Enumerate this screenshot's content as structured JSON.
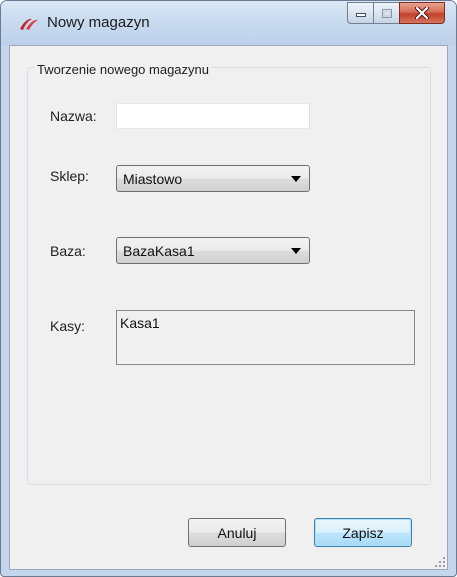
{
  "window": {
    "title": "Nowy magazyn",
    "icon": "app-logo-icon",
    "caption": {
      "minimize_icon": "minimize-icon",
      "maximize_icon": "maximize-icon",
      "close_icon": "close-icon"
    }
  },
  "group": {
    "title": "Tworzenie nowego magazynu"
  },
  "form": {
    "name": {
      "label": "Nazwa:",
      "value": ""
    },
    "shop": {
      "label": "Sklep:",
      "selected": "Miastowo"
    },
    "database": {
      "label": "Baza:",
      "selected": "BazaKasa1"
    },
    "registers": {
      "label": "Kasy:",
      "items": [
        "Kasa1"
      ]
    }
  },
  "buttons": {
    "cancel": "Anuluj",
    "save": "Zapisz"
  },
  "colors": {
    "accent": "#3c7fb1",
    "close_button": "#c2402a",
    "logo": "#c0282d"
  }
}
